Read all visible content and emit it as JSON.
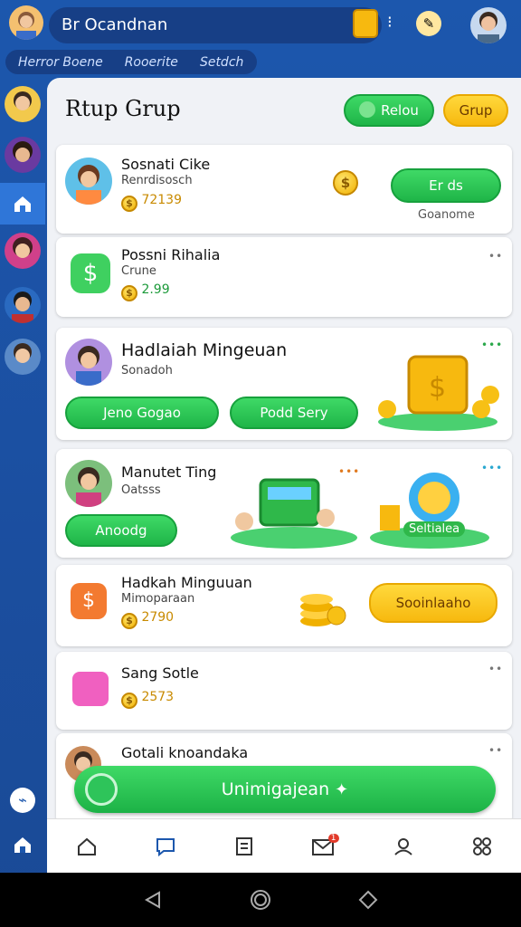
{
  "app": {
    "title": "Br Ocandnan"
  },
  "tabs": [
    "Herror Boene",
    "Rooerite",
    "Setdch"
  ],
  "main": {
    "title": "Rtup Grup",
    "btn_green": "Relou",
    "btn_yellow": "Grup"
  },
  "cards": [
    {
      "title": "Sosnati Cike",
      "subtitle": "Renrdisosch",
      "value": "72139",
      "action": "Er ds",
      "caption": "Goanome"
    },
    {
      "title": "Possni Rihalia",
      "subtitle": "Crune",
      "value": "2.99"
    },
    {
      "title": "Hadlaiah Mingeuan",
      "subtitle": "Sonadoh",
      "btn_left": "Jeno Gogao",
      "btn_right": "Podd Sery"
    },
    {
      "title": "Manutet Ting",
      "subtitle": "Oatsss",
      "btn": "Anoodg",
      "badge": "Seltialea"
    },
    {
      "title": "Hadkah Minguuan",
      "subtitle": "Mimoparaan",
      "value": "2790",
      "action": "Sooinlaaho"
    },
    {
      "title": "Sang Sotle",
      "value": "2573"
    },
    {
      "title": "Gotali knoandaka"
    }
  ],
  "fab": {
    "label": "Unimigajean"
  },
  "notif_count": "1",
  "colors": {
    "primary": "#1c57ad",
    "green": "#22b84a",
    "yellow": "#f7c015"
  }
}
